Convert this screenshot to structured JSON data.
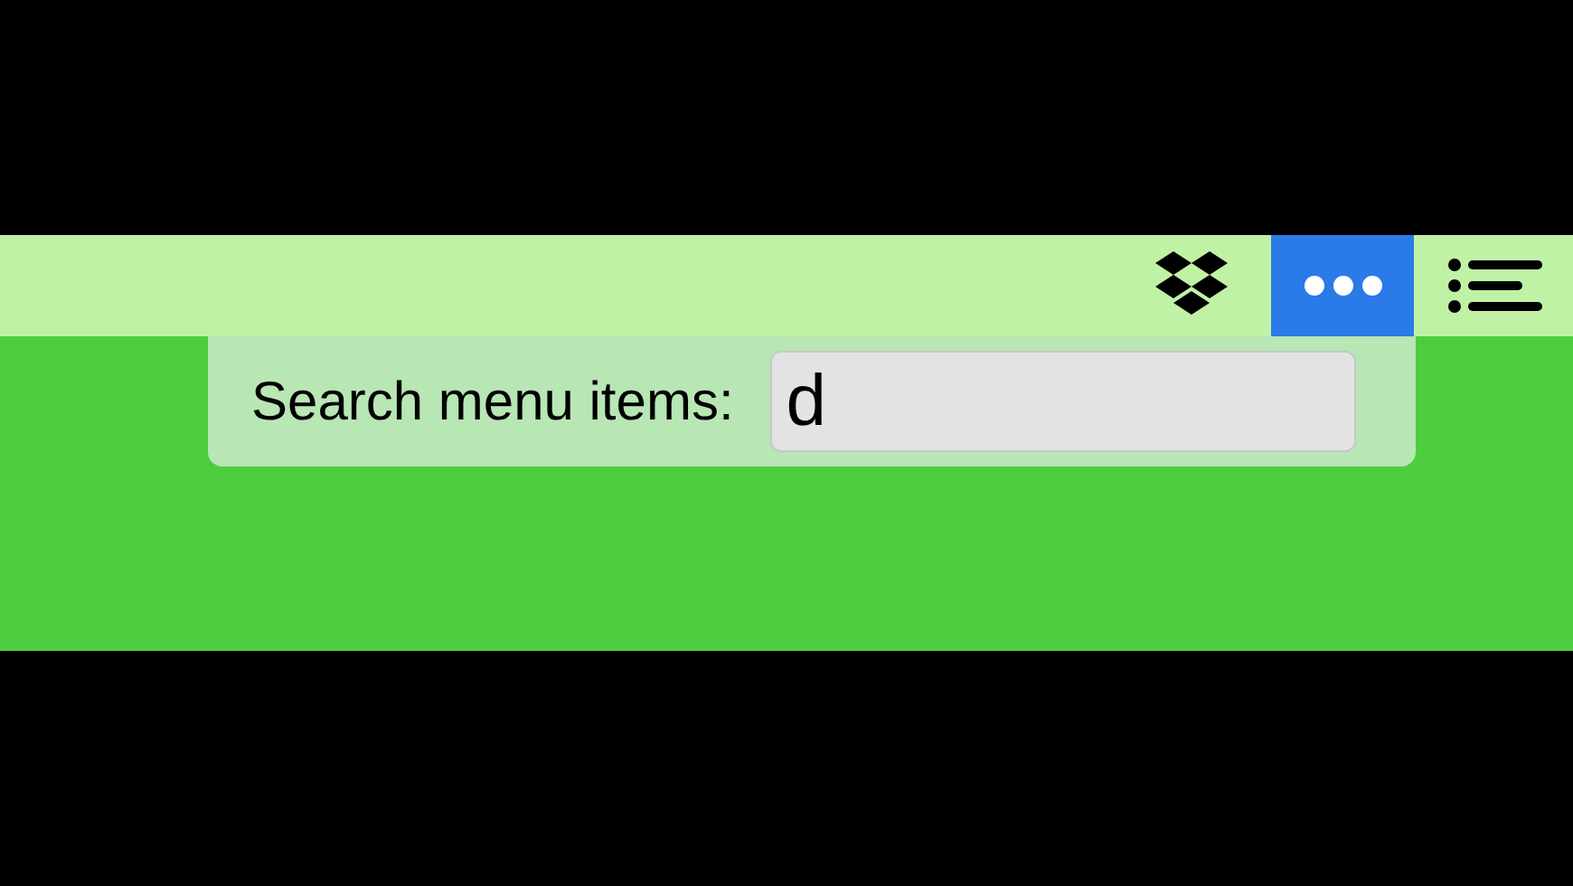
{
  "menu_bar": {
    "items": [
      {
        "kind": "dropbox",
        "selected": false
      },
      {
        "kind": "more",
        "selected": true
      },
      {
        "kind": "list",
        "selected": false
      }
    ]
  },
  "search_popup": {
    "label": "Search menu items:",
    "value": "d"
  }
}
